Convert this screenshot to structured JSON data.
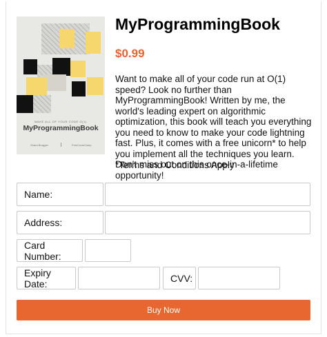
{
  "product": {
    "title": "MyProgrammingBook",
    "price": "$0.99",
    "description": "Want to make all of your code run at O(1) speed? Look no further than MyProgrammingBook! Written by me, the world's leading expert on algorithmic optimization, this book will teach you everything you need to know to make your code lightning fast. Plus, it comes with a free unicorn* to help you implement all the techniques you learn. Don't miss out on this once-in-a-lifetime opportunity!",
    "terms": "*Terms and Conditions Apply",
    "price_color": "#e8622f"
  },
  "cover": {
    "tagline": "MAKE ALL OF YOUR CODE O(1)",
    "title": "MyProgrammingBook",
    "author": "Shara Brugger",
    "publisher": "FreeCodeCamp",
    "accent_color": "#f5d76e"
  },
  "form": {
    "name_label": "Name:",
    "name_value": "",
    "address_label": "Address:",
    "address_value": "",
    "card_label": "Card Number:",
    "card_value": "",
    "expiry_label": "Expiry Date:",
    "expiry_value": "",
    "cvv_label": "CVV:",
    "cvv_value": ""
  },
  "buy_button": {
    "label": "Buy Now",
    "color": "#e8662f"
  }
}
